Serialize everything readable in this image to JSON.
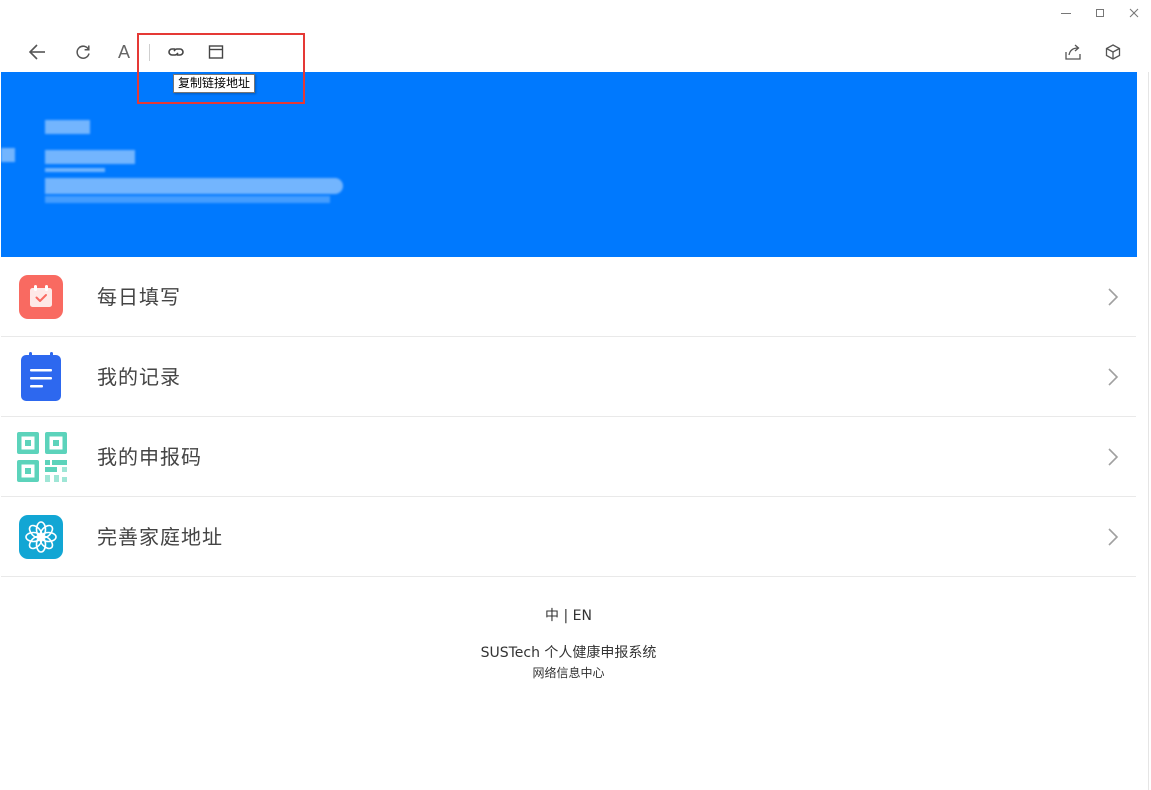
{
  "window": {
    "minimize_icon": "minimize-icon",
    "maximize_icon": "maximize-icon",
    "close_icon": "close-icon"
  },
  "toolbar": {
    "font_label": "A",
    "tooltip": "复制链接地址"
  },
  "colors": {
    "banner": "#0079fe",
    "highlight": "#e53935",
    "daily_icon": "#f96a61",
    "records_icon": "#2d68ef",
    "qrcode_icon": "#5cd3bb",
    "address_icon": "#12a6d4"
  },
  "menu": {
    "items": [
      {
        "label": "每日填写",
        "icon": "calendar-check-icon"
      },
      {
        "label": "我的记录",
        "icon": "notepad-icon"
      },
      {
        "label": "我的申报码",
        "icon": "qrcode-icon"
      },
      {
        "label": "完善家庭地址",
        "icon": "flower-icon"
      }
    ]
  },
  "footer": {
    "lang_zh": "中",
    "lang_sep": " | ",
    "lang_en": "EN",
    "system_title": "SUSTech 个人健康申报系统",
    "org": "网络信息中心"
  }
}
